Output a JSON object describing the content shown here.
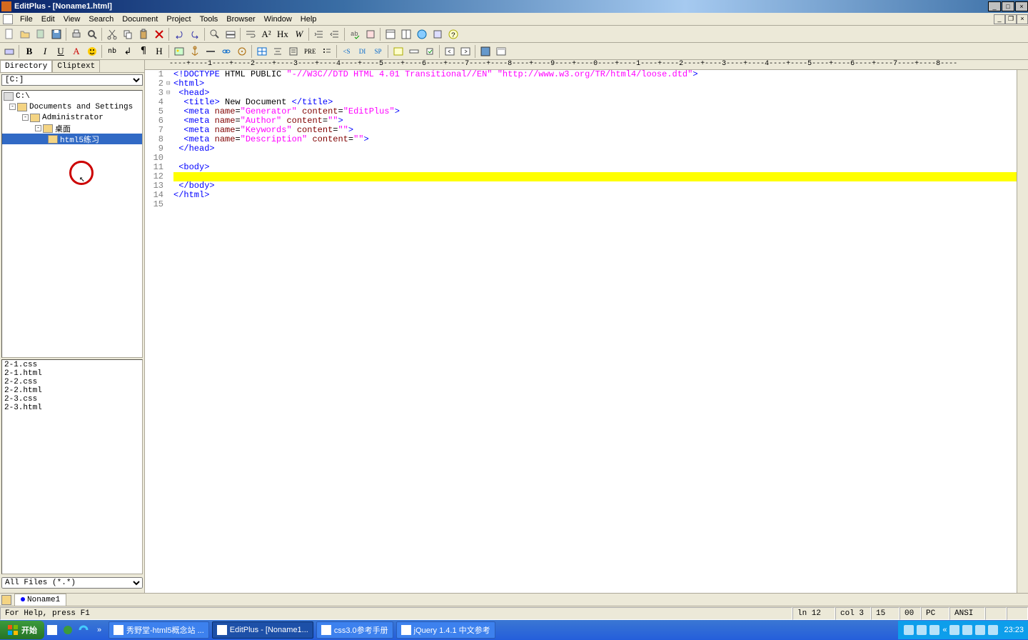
{
  "titlebar": {
    "app": "EditPlus",
    "doc": "[Noname1.html]"
  },
  "menu": [
    "File",
    "Edit",
    "View",
    "Search",
    "Document",
    "Project",
    "Tools",
    "Browser",
    "Window",
    "Help"
  ],
  "sidebar": {
    "tabs": [
      "Directory",
      "Cliptext"
    ],
    "drive": "[C:]",
    "tree": [
      {
        "indent": 0,
        "toggle": "",
        "icon": "drive",
        "label": "C:\\",
        "sel": false
      },
      {
        "indent": 1,
        "toggle": "-",
        "icon": "folder",
        "label": "Documents and Settings",
        "sel": false
      },
      {
        "indent": 2,
        "toggle": "-",
        "icon": "folder",
        "label": "Administrator",
        "sel": false
      },
      {
        "indent": 3,
        "toggle": "-",
        "icon": "folder",
        "label": "桌面",
        "sel": false
      },
      {
        "indent": 4,
        "toggle": "",
        "icon": "folder",
        "label": "html5练习",
        "sel": true
      }
    ],
    "files": [
      "2-1.css",
      "2-1.html",
      "2-2.css",
      "2-2.html",
      "2-3.css",
      "2-3.html"
    ],
    "filter": "All Files (*.*)"
  },
  "ruler": "----+----1----+----2----+----3----+----4----+----5----+----6----+----7----+----8----+----9----+----0----+----1----+----2----+----3----+----4----+----5----+----6----+----7----+----8----",
  "code": {
    "lines": [
      {
        "n": 1,
        "fold": "",
        "html": "<span class='t-blue'>&lt;!DOCTYPE</span> <span class='t-black'>HTML PUBLIC </span><span class='t-str'>\"-//W3C//DTD HTML 4.01 Transitional//EN\"</span> <span class='t-str'>\"http://www.w3.org/TR/html4/loose.dtd\"</span><span class='t-blue'>&gt;</span>"
      },
      {
        "n": 2,
        "fold": "⊟",
        "html": "<span class='t-blue'>&lt;html&gt;</span>"
      },
      {
        "n": 3,
        "fold": "⊟",
        "html": " <span class='t-blue'>&lt;head&gt;</span>"
      },
      {
        "n": 4,
        "fold": "",
        "html": "  <span class='t-blue'>&lt;title&gt;</span><span class='t-black'> New Document </span><span class='t-blue'>&lt;/title&gt;</span>"
      },
      {
        "n": 5,
        "fold": "",
        "html": "  <span class='t-blue'>&lt;meta</span> <span class='t-red'>name</span>=<span class='t-str'>\"Generator\"</span> <span class='t-red'>content</span>=<span class='t-str'>\"EditPlus\"</span><span class='t-blue'>&gt;</span>"
      },
      {
        "n": 6,
        "fold": "",
        "html": "  <span class='t-blue'>&lt;meta</span> <span class='t-red'>name</span>=<span class='t-str'>\"Author\"</span> <span class='t-red'>content</span>=<span class='t-str'>\"\"</span><span class='t-blue'>&gt;</span>"
      },
      {
        "n": 7,
        "fold": "",
        "html": "  <span class='t-blue'>&lt;meta</span> <span class='t-red'>name</span>=<span class='t-str'>\"Keywords\"</span> <span class='t-red'>content</span>=<span class='t-str'>\"\"</span><span class='t-blue'>&gt;</span>"
      },
      {
        "n": 8,
        "fold": "",
        "html": "  <span class='t-blue'>&lt;meta</span> <span class='t-red'>name</span>=<span class='t-str'>\"Description\"</span> <span class='t-red'>content</span>=<span class='t-str'>\"\"</span><span class='t-blue'>&gt;</span>"
      },
      {
        "n": 9,
        "fold": "",
        "html": " <span class='t-blue'>&lt;/head&gt;</span>"
      },
      {
        "n": 10,
        "fold": "",
        "html": ""
      },
      {
        "n": 11,
        "fold": "",
        "html": " <span class='t-blue'>&lt;body&gt;</span>"
      },
      {
        "n": 12,
        "fold": "",
        "html": "  ",
        "hl": true
      },
      {
        "n": 13,
        "fold": "",
        "html": " <span class='t-blue'>&lt;/body&gt;</span>"
      },
      {
        "n": 14,
        "fold": "",
        "html": "<span class='t-blue'>&lt;/html&gt;</span>"
      },
      {
        "n": 15,
        "fold": "",
        "html": ""
      }
    ]
  },
  "doc_tab": {
    "name": "Noname1"
  },
  "status": {
    "help": "For Help, press F1",
    "line": "ln 12",
    "col": "col 3",
    "count": "15",
    "ovr": "00",
    "mode": "PC",
    "enc": "ANSI"
  },
  "taskbar": {
    "start": "开始",
    "tasks": [
      {
        "label": "秀野堂-html5概念站 ...",
        "active": false
      },
      {
        "label": "EditPlus - [Noname1...",
        "active": true
      },
      {
        "label": "css3.0参考手册",
        "active": false
      },
      {
        "label": "jQuery 1.4.1 中文参考",
        "active": false
      }
    ],
    "time": "23:23"
  }
}
